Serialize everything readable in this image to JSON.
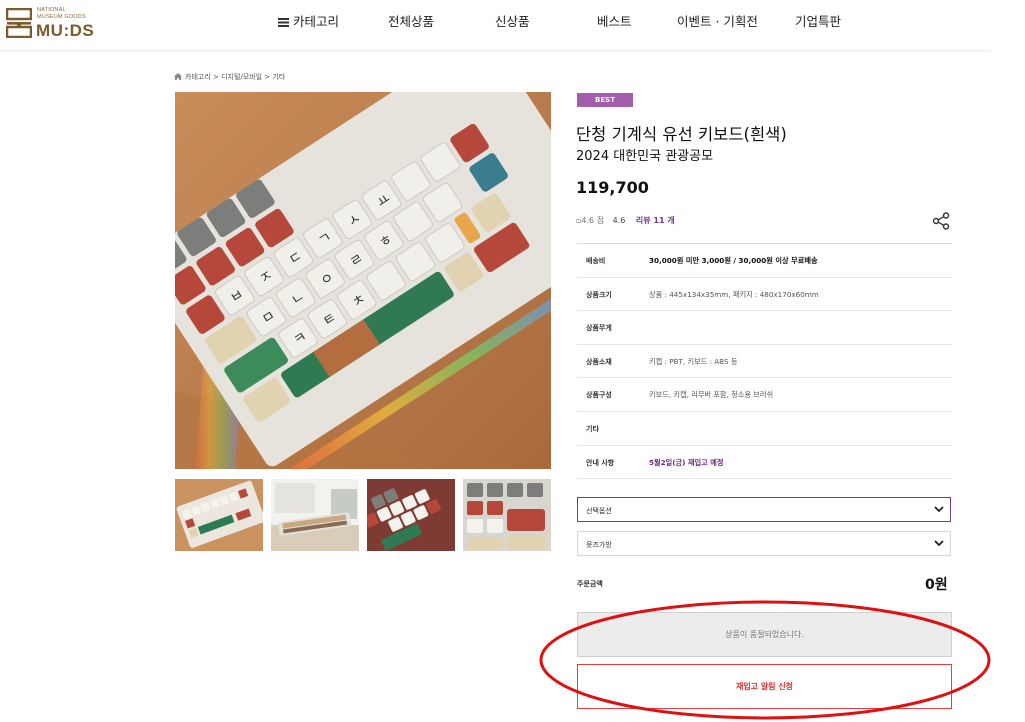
{
  "header": {
    "logo": {
      "small_text": [
        "NATIONAL",
        "MUSEUM GOODS"
      ],
      "big_text": "MU:DS"
    },
    "nav": [
      {
        "label": "카테고리",
        "icon": "menu-icon"
      },
      {
        "label": "전체상품"
      },
      {
        "label": "신상품"
      },
      {
        "label": "베스트"
      },
      {
        "label": "이벤트 · 기획전"
      },
      {
        "label": "기업특판"
      }
    ]
  },
  "breadcrumb": {
    "icon": "home-icon",
    "text": "카테고리 > 디지털/모바일 > 기타"
  },
  "product": {
    "badge": "BEST",
    "title": "단청 기계식 유선 키보드(흰색)",
    "subtitle": "2024 대한민국 관광공모",
    "price": "119,700",
    "rating_img_alt": "4.6 점",
    "rating_value": "4.6",
    "review_label": "리뷰 11 개",
    "share_icon": "share-icon",
    "thumbnail_count": 4
  },
  "info": [
    {
      "label": "배송비",
      "value": "30,000원 미만 3,000원 / 30,000원 이상 무료배송",
      "style": "bold"
    },
    {
      "label": "상품크기",
      "value": "상품 : 445x134x35mm, 패키지 : 480x170x60mm",
      "style": "normal"
    },
    {
      "label": "상품무게",
      "value": "",
      "style": "normal"
    },
    {
      "label": "상품소재",
      "value": "키캡 : PBT, 키보드 : ABS 등",
      "style": "normal"
    },
    {
      "label": "상품구성",
      "value": "키보드, 키캡, 리무버 포함, 청소용 브러쉬",
      "style": "normal"
    },
    {
      "label": "기타",
      "value": "",
      "style": "normal"
    },
    {
      "label": "안내 사항",
      "value": "5월2일(금) 재입고 예정",
      "style": "purple"
    }
  ],
  "options": {
    "select_1": "선택옵션",
    "select_2": "뮷즈가방"
  },
  "order": {
    "label": "주문금액",
    "amount": "0원"
  },
  "buttons": {
    "soldout": "상품이 품절되었습니다.",
    "restock": "재입고 알림 신청"
  },
  "colors": {
    "accent": "#a25dad",
    "brand": "#7a5c2e",
    "restock_red": "#e03030",
    "annotation_red": "#dd1111"
  }
}
